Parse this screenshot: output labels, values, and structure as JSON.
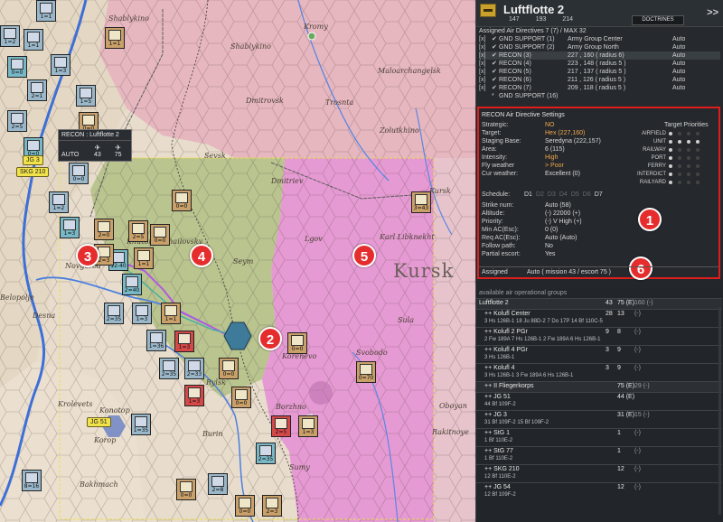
{
  "map": {
    "towns": [
      {
        "name": "Shablykino"
      },
      {
        "name": "Kromy"
      },
      {
        "name": "Maloarchangelsk"
      },
      {
        "name": "Trosnta"
      },
      {
        "name": "Dmitrovsk"
      },
      {
        "name": "Sevsk"
      },
      {
        "name": "Zolutkhino"
      },
      {
        "name": "Dmitriev"
      },
      {
        "name": "Kursk"
      },
      {
        "name": "Karl Libknekht"
      },
      {
        "name": "Khutor Mikhailovsky"
      },
      {
        "name": "Lgov"
      },
      {
        "name": "Sula"
      },
      {
        "name": "Svobodo"
      },
      {
        "name": "Korenevo"
      },
      {
        "name": "Belopolje"
      },
      {
        "name": "Korop"
      },
      {
        "name": "Konotop"
      },
      {
        "name": "Krolevets"
      },
      {
        "name": "Burin"
      },
      {
        "name": "Rylsk"
      },
      {
        "name": "Borzhno"
      },
      {
        "name": "Bakhmach"
      },
      {
        "name": "Sumy"
      },
      {
        "name": "Rakitnoye"
      },
      {
        "name": "Oboyan"
      },
      {
        "name": "Novgorod"
      },
      {
        "name": "Desna"
      },
      {
        "name": "Seym"
      }
    ],
    "region_label": "Kursk",
    "tooltip": {
      "title": "RECON : Luftflotte 2",
      "mode": "AUTO",
      "fighters": "43",
      "bombers": "75"
    },
    "air_tags": [
      {
        "label": "JG 3"
      },
      {
        "label": "SKG 210"
      },
      {
        "label": "JG 51"
      }
    ],
    "callouts": [
      "1",
      "2",
      "3",
      "4",
      "5",
      "6"
    ],
    "units": [
      {
        "val": "1=1"
      },
      {
        "val": "1=2"
      },
      {
        "val": "1=1"
      },
      {
        "val": "0=0"
      },
      {
        "val": "1=3"
      },
      {
        "val": "2=1"
      },
      {
        "val": "1=5"
      },
      {
        "val": "2=5"
      },
      {
        "val": "0=0"
      },
      {
        "val": "0=0"
      },
      {
        "val": "1=2"
      },
      {
        "val": "1=3"
      },
      {
        "val": "3=43"
      },
      {
        "val": "0=0"
      },
      {
        "val": "2=0"
      },
      {
        "val": "2=5"
      },
      {
        "val": "0=0"
      },
      {
        "val": "2=3"
      },
      {
        "val": "12-40"
      },
      {
        "val": "2=40"
      },
      {
        "val": "1=1"
      },
      {
        "val": "1=1"
      },
      {
        "val": "1=3"
      },
      {
        "val": "0=0"
      },
      {
        "val": "0=0"
      },
      {
        "val": "0=70"
      },
      {
        "val": "1=3"
      },
      {
        "val": "2=5"
      },
      {
        "val": "2=35"
      },
      {
        "val": "1=3"
      },
      {
        "val": "2=8"
      },
      {
        "val": "8=16"
      },
      {
        "val": "2=35"
      },
      {
        "val": "1=36"
      },
      {
        "val": "2=33"
      },
      {
        "val": "1=35"
      }
    ]
  },
  "panel": {
    "title": "Luftflotte 2",
    "stats": [
      "147",
      "193",
      "214"
    ],
    "doctrines_label": "DOCTRINES",
    "next_label": ">>",
    "directives_header": "Assigned Air Directives 7 (7) / MAX 32",
    "directives": [
      {
        "cb": "[x]",
        "name": "GND SUPPORT (1)",
        "target": "Army Group Center",
        "mode": "Auto"
      },
      {
        "cb": "[x]",
        "name": "GND SUPPORT (2)",
        "target": "Army Group North",
        "mode": "Auto"
      },
      {
        "cb": "[x]",
        "name": "RECON (3)",
        "target": "227 , 160 ( radius 6)",
        "mode": "Auto"
      },
      {
        "cb": "[x]",
        "name": "RECON (4)",
        "target": "223 , 148 ( radius 5 )",
        "mode": "Auto"
      },
      {
        "cb": "[x]",
        "name": "RECON (5)",
        "target": "217 , 137 ( radius 5 )",
        "mode": "Auto"
      },
      {
        "cb": "[x]",
        "name": "RECON (6)",
        "target": "211 , 126 ( radius 5 )",
        "mode": "Auto"
      },
      {
        "cb": "[x]",
        "name": "RECON (7)",
        "target": "209 , 118 ( radius 5 )",
        "mode": "Auto"
      },
      {
        "cb": "",
        "name": "GND SUPPORT (16)",
        "target": "",
        "mode": ""
      }
    ],
    "settings": {
      "header": "RECON Air Directive Settings",
      "rows": [
        {
          "k": "Strategic:",
          "v": "NO"
        },
        {
          "k": "Target:",
          "v": "Hex (227,160)"
        },
        {
          "k": "Staging Base:",
          "v": "Seredyna (222,157)"
        },
        {
          "k": "Area:",
          "v": "6 (115)"
        },
        {
          "k": "Intensity:",
          "v": "High"
        },
        {
          "k": "Fly weather",
          "v": "> Poor"
        },
        {
          "k": "Cur weather:",
          "v": "Excellent (0)"
        }
      ],
      "schedule_label": "Schedule:",
      "schedule_days": [
        "D1",
        "D2",
        "D3",
        "D4",
        "D5",
        "D6",
        "D7"
      ],
      "rows2": [
        {
          "k": "Strike num:",
          "v": "Auto (58)"
        },
        {
          "k": "Altitude:",
          "v": "(-) 22000 (+)"
        },
        {
          "k": "Priority:",
          "v": "(-) V High (+)"
        },
        {
          "k": "Min AC(Esc):",
          "v": "0 (0)"
        },
        {
          "k": "Req AC(Esc):",
          "v": "Auto (Auto)"
        },
        {
          "k": "Follow path:",
          "v": "No"
        },
        {
          "k": "Partial escort:",
          "v": "Yes"
        }
      ],
      "target_priorities_title": "Target Priorities",
      "target_priorities": [
        {
          "label": "AIRFIELD"
        },
        {
          "label": "UNIT"
        },
        {
          "label": "RAILWAY"
        },
        {
          "label": "PORT"
        },
        {
          "label": "FERRY"
        },
        {
          "label": "INTERDICT"
        },
        {
          "label": "RAILYARD"
        }
      ],
      "assigned_label": "Assigned",
      "assigned_value": "Auto  ( mission 43 / escort 75 )"
    },
    "groups_header": "available air operational groups",
    "groups": [
      {
        "name": "Luftflotte 2",
        "n1": "43",
        "n2": "75 (E)",
        "n3": "160 (-)",
        "sub": ""
      },
      {
        "name": "++ Kolufl Center",
        "n1": "28",
        "n2": "13",
        "n3": "(-)",
        "sub": "3 Hs 126B-1   18 Ju 88D-2   7 Do 17P   14 Bf 110C-5"
      },
      {
        "name": "++ Kolufl 2 PGr",
        "n1": "9",
        "n2": "8",
        "n3": "(-)",
        "sub": "2 Fw 189A   7 Hs 126B-1   2 Fw 189A   6 Hs 126B-1"
      },
      {
        "name": "++ Kolufl 4 PGr",
        "n1": "3",
        "n2": "9",
        "n3": "(-)",
        "sub": "3 Hs 126B-1"
      },
      {
        "name": "++ Kolufl 4",
        "n1": "3",
        "n2": "9",
        "n3": "(-)",
        "sub": "3 Hs 126B-1   3 Fw 189A   6 Hs 126B-1"
      },
      {
        "name": "++ II Fliegerkorps",
        "n1": "",
        "n2": "75 (E)",
        "n3": "29 (-)",
        "sub": ""
      },
      {
        "name": "++ JG 51",
        "n1": "",
        "n2": "44 (E)",
        "n3": "",
        "sub": "44 Bf 109F-2"
      },
      {
        "name": "++ JG 3",
        "n1": "",
        "n2": "31 (E)",
        "n3": "15 (-)",
        "sub": "31 Bf 109F-2   15 Bf 109F-2"
      },
      {
        "name": "++ StG 1",
        "n1": "",
        "n2": "1",
        "n3": "(-)",
        "sub": "1 Bf 110E-2"
      },
      {
        "name": "++ StG 77",
        "n1": "",
        "n2": "1",
        "n3": "(-)",
        "sub": "1 Bf 110E-2"
      },
      {
        "name": "++ SKG 210",
        "n1": "",
        "n2": "12",
        "n3": "(-)",
        "sub": "12 Bf 110E-2"
      },
      {
        "name": "++ JG 54",
        "n1": "",
        "n2": "12",
        "n3": "(-)",
        "sub": "12 Bf 109F-2"
      }
    ]
  }
}
